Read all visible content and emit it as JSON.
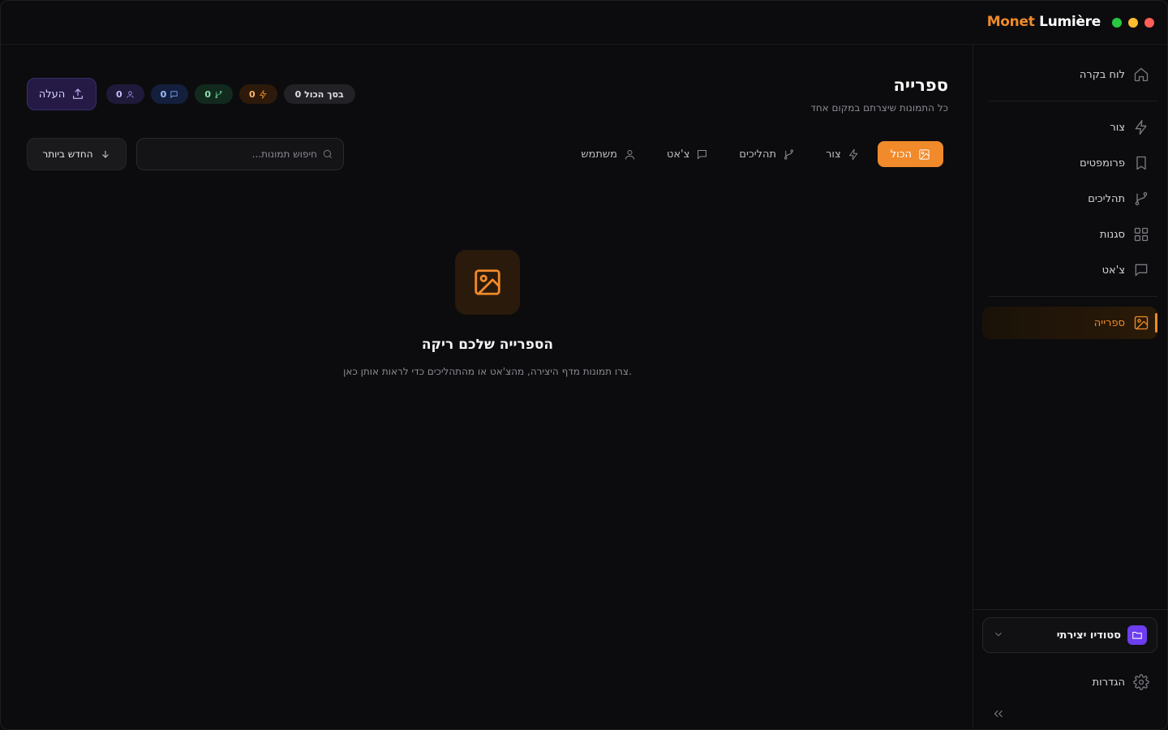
{
  "app": {
    "brand_primary": "Monet",
    "brand_secondary": "Lumière",
    "accent_color": "#f08a2a",
    "traffic_lights": [
      "#ff5f57",
      "#febc2e",
      "#28c840"
    ]
  },
  "sidebar": {
    "items": [
      {
        "label": "לוח בקרה",
        "icon": "home-icon"
      },
      {
        "label": "צור",
        "icon": "lightning-icon"
      },
      {
        "label": "פרומפטים",
        "icon": "bookmark-icon"
      },
      {
        "label": "תהליכים",
        "icon": "git-branch-icon"
      },
      {
        "label": "סגנות",
        "icon": "grid-icon"
      },
      {
        "label": "צ'אט",
        "icon": "chat-icon"
      },
      {
        "label": "ספרייה",
        "icon": "image-icon",
        "active": true
      }
    ],
    "workspace": {
      "label": "סטודיו יצירתי",
      "icon": "folder-icon"
    },
    "settings_label": "הגדרות"
  },
  "header": {
    "title": "ספרייה",
    "subtitle": "כל התמונות שיצרתם במקום אחד",
    "upload_label": "העלה"
  },
  "stats": {
    "total": "0 בסך הכול",
    "generate": "0",
    "workflows": "0",
    "chat": "0",
    "users": "0"
  },
  "tabs": [
    {
      "label": "הכול",
      "icon": "image-icon",
      "active": true
    },
    {
      "label": "צור",
      "icon": "lightning-icon"
    },
    {
      "label": "תהליכים",
      "icon": "git-branch-icon"
    },
    {
      "label": "צ'אט",
      "icon": "chat-icon"
    },
    {
      "label": "משתמש",
      "icon": "user-icon"
    }
  ],
  "search": {
    "placeholder": "חיפוש תמונות...",
    "value": ""
  },
  "sort": {
    "label": "החדש ביותר"
  },
  "empty_state": {
    "title": "הספרייה שלכם ריקה",
    "subtitle": "צרו תמונות מדף היצירה, מהצ'אט או מהתהליכים כדי לראות אותן כאן."
  }
}
